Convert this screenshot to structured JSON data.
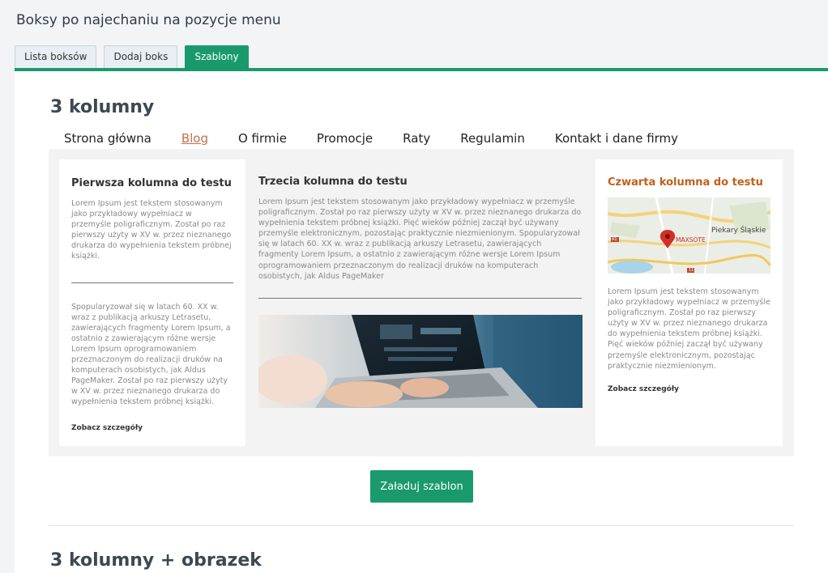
{
  "page": {
    "title": "Boksy po najechaniu na pozycje menu"
  },
  "tabs": [
    {
      "label": "Lista boksów"
    },
    {
      "label": "Dodaj boks"
    },
    {
      "label": "Szablony"
    }
  ],
  "section1": {
    "heading": "3 kolumny",
    "menu": [
      "Strona główna",
      "Blog",
      "O firmie",
      "Promocje",
      "Raty",
      "Regulamin",
      "Kontakt i dane firmy"
    ],
    "col1": {
      "title": "Pierwsza kolumna do testu",
      "text1": "Lorem Ipsum jest tekstem stosowanym jako przykładowy wypełniacz w przemyśle poligraficznym. Został po raz pierwszy użyty w XV w. przez nieznanego drukarza do wypełnienia tekstem próbnej książki.",
      "text2": "Spopularyzował się w latach 60. XX w. wraz z publikacją arkuszy Letrasetu, zawierających fragmenty Lorem Ipsum, a ostatnio z zawierającym różne wersje Lorem Ipsum oprogramowaniem przeznaczonym do realizacji druków na komputerach osobistych, jak Aldus PageMaker. Został po raz pierwszy użyty w XV w. przez nieznanego drukarza do wypełnienia tekstem próbnej książki.",
      "more": "Zobacz szczegóły"
    },
    "col3": {
      "title": "Trzecia kolumna do testu",
      "text": "Lorem Ipsum jest tekstem stosowanym jako przykładowy wypełniacz w przemyśle poligraficznym. Został po raz pierwszy użyty w XV w. przez nieznanego drukarza do wypełnienia tekstem próbnej książki. Pięć wieków później zaczął być używany przemyśle elektronicznym, pozostając praktycznie niezmienionym. Spopularyzował się w latach 60. XX w. wraz z publikacją arkuszy Letrasetu, zawierających fragmenty Lorem Ipsum, a ostatnio z zawierającym różne wersje Lorem Ipsum oprogramowaniem przeznaczonym do realizacji druków na komputerach osobistych, jak Aldus PageMaker"
    },
    "col4": {
      "title": "Czwarta kolumna do testu",
      "map_labels": {
        "city": "Piekary Śląskie",
        "marker": "MAXSOTE",
        "road1": "A1",
        "road2": "11"
      },
      "text": "Lorem Ipsum jest tekstem stosowanym jako przykładowy wypełniacz w przemyśle poligraficznym. Został po raz pierwszy użyty w XV w. przez nieznanego drukarza do wypełnienia tekstem próbnej książki. Pięć wieków później zaczął być używany przemyśle elektronicznym, pozostając praktycznie niezmienionym.",
      "more": "Zobacz szczegóły"
    },
    "button": "Załaduj szablon"
  },
  "section2": {
    "heading": "3 kolumny + obrazek"
  },
  "colors": {
    "accent": "#1a9a6c",
    "active_menu": "#c0714f",
    "col4_title": "#c0601c"
  }
}
